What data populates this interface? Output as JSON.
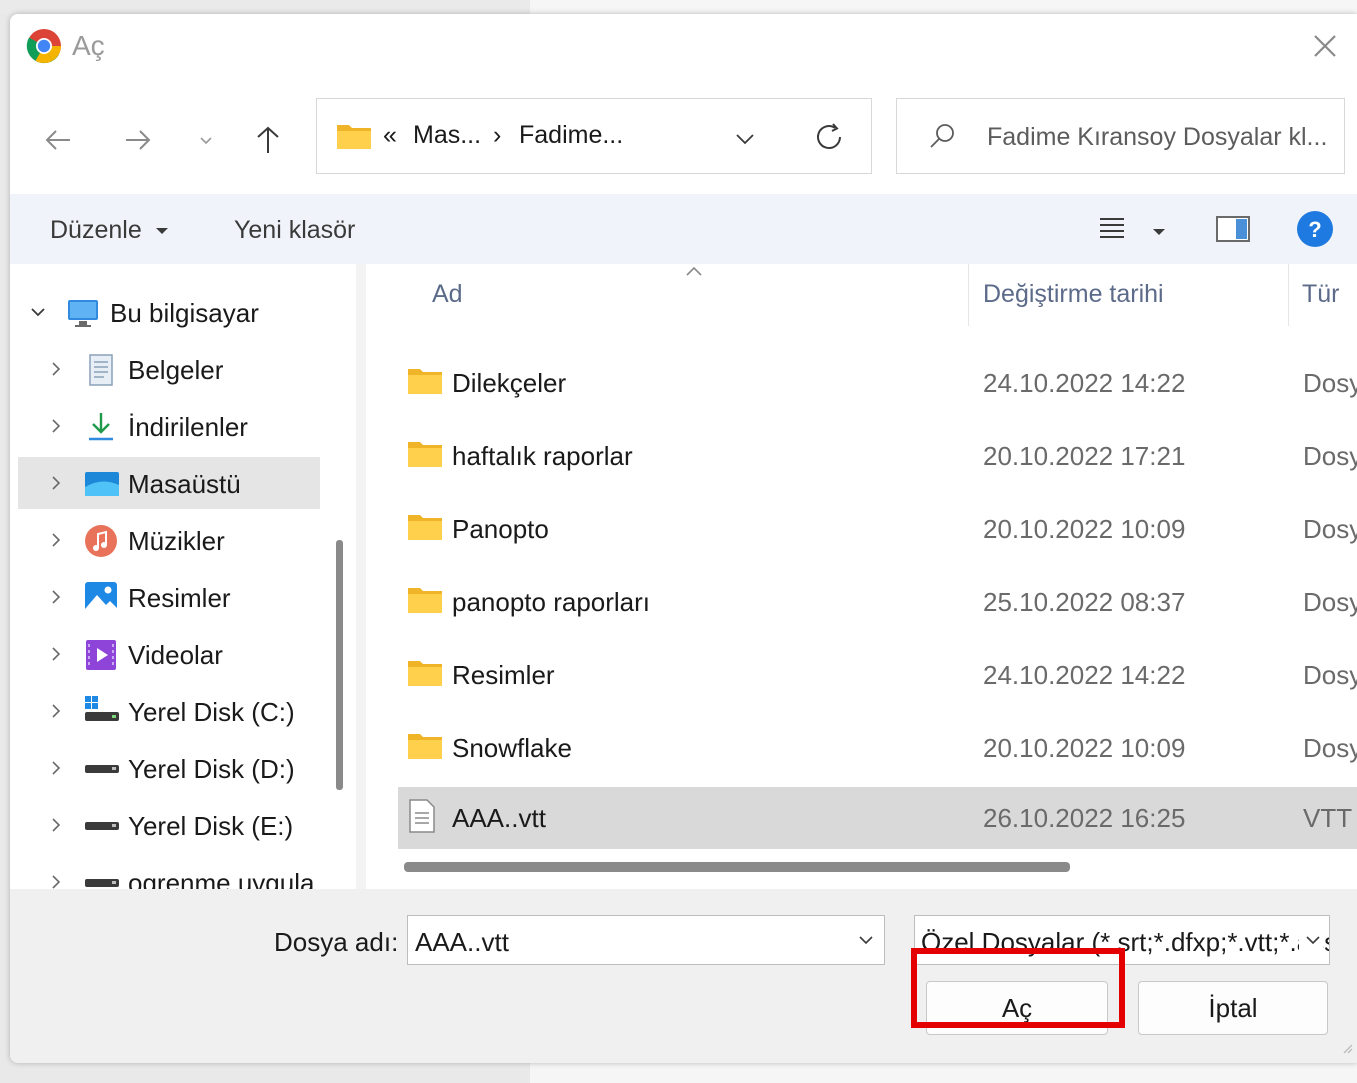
{
  "window": {
    "title": "Aç",
    "app_icon": "chrome-icon",
    "close_icon": "close-icon"
  },
  "nav": {
    "back_icon": "arrow-left-icon",
    "forward_icon": "arrow-right-icon",
    "recent_icon": "chevron-down-icon",
    "up_icon": "arrow-up-icon",
    "address": {
      "overflow": "«",
      "crumbs": [
        "Mas...",
        "Fadime..."
      ],
      "separator": "›"
    },
    "refresh_icon": "refresh-icon",
    "search_placeholder": "Fadime Kıransoy Dosyalar kl..."
  },
  "toolbar": {
    "organize_label": "Düzenle",
    "new_folder_label": "Yeni klasör",
    "view_icon": "list-view-icon",
    "preview_icon": "preview-pane-icon",
    "help_icon": "help-icon",
    "help_color": "#1e7ae0"
  },
  "sidebar": {
    "items": [
      {
        "label": "Bu bilgisayar",
        "icon": "computer-icon",
        "expanded": true,
        "level": 0
      },
      {
        "label": "Belgeler",
        "icon": "documents-icon",
        "level": 1
      },
      {
        "label": "İndirilenler",
        "icon": "downloads-icon",
        "level": 1
      },
      {
        "label": "Masaüstü",
        "icon": "desktop-icon",
        "level": 1,
        "selected": true
      },
      {
        "label": "Müzikler",
        "icon": "music-icon",
        "level": 1
      },
      {
        "label": "Resimler",
        "icon": "pictures-icon",
        "level": 1
      },
      {
        "label": "Videolar",
        "icon": "videos-icon",
        "level": 1
      },
      {
        "label": "Yerel Disk (C:)",
        "icon": "windows-drive-icon",
        "level": 1
      },
      {
        "label": "Yerel Disk (D:)",
        "icon": "drive-icon",
        "level": 1
      },
      {
        "label": "Yerel Disk (E:)",
        "icon": "drive-icon",
        "level": 1
      },
      {
        "label": "ogrenme uygula",
        "icon": "drive-icon",
        "level": 1
      }
    ]
  },
  "files": {
    "columns": {
      "name": "Ad",
      "date": "Değiştirme tarihi",
      "type": "Tür"
    },
    "rows": [
      {
        "name": "Dilekçeler",
        "date": "24.10.2022 14:22",
        "type": "Dosya",
        "icon": "folder-icon"
      },
      {
        "name": "haftalık raporlar",
        "date": "20.10.2022 17:21",
        "type": "Dosya",
        "icon": "folder-icon"
      },
      {
        "name": "Panopto",
        "date": "20.10.2022 10:09",
        "type": "Dosya",
        "icon": "folder-icon"
      },
      {
        "name": "panopto raporları",
        "date": "25.10.2022 08:37",
        "type": "Dosya",
        "icon": "folder-icon"
      },
      {
        "name": "Resimler",
        "date": "24.10.2022 14:22",
        "type": "Dosya",
        "icon": "folder-icon"
      },
      {
        "name": "Snowflake",
        "date": "20.10.2022 10:09",
        "type": "Dosya",
        "icon": "folder-icon"
      },
      {
        "name": "AAA..vtt",
        "date": "26.10.2022 16:25",
        "type": "VTT",
        "icon": "text-file-icon",
        "selected": true
      }
    ]
  },
  "footer": {
    "filename_label": "Dosya adı:",
    "filename_value": "AAA..vtt",
    "filetype_value": "Özel Dosyalar (*.srt;*.dfxp;*.vtt;*.ass)",
    "open_label": "Aç",
    "cancel_label": "İptal",
    "highlight_color": "#e40000"
  }
}
